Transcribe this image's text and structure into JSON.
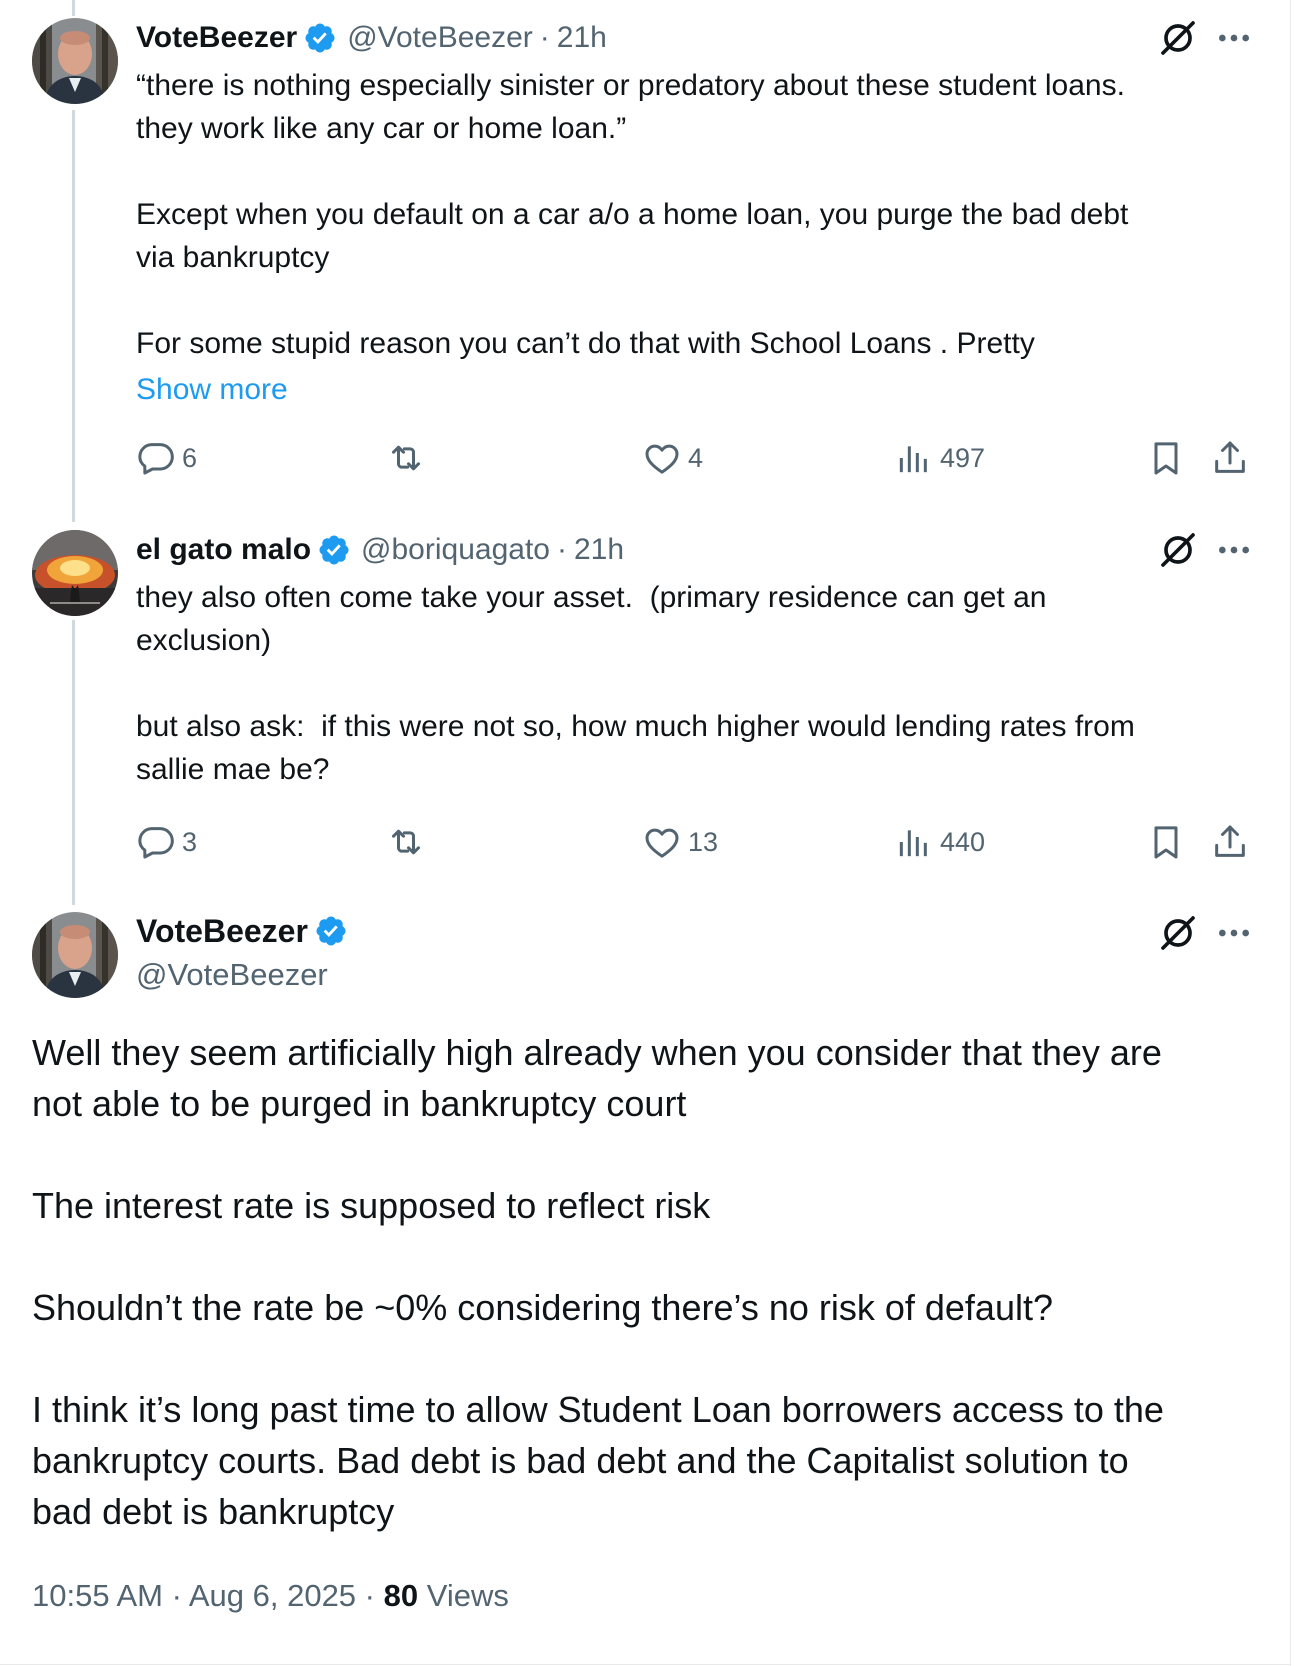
{
  "tweets": [
    {
      "name": "VoteBeezer",
      "handle": "@VoteBeezer",
      "separator": "·",
      "time": "21h",
      "text": "“there is nothing especially sinister or predatory about these student loans.\nthey work like any car or home loan.”\n\nExcept when you default on a car a/o a home loan, you purge the bad debt\nvia bankruptcy\n\nFor some stupid reason you can’t do that with School Loans . Pretty",
      "show_more": "Show more",
      "replies": "6",
      "reposts": "",
      "likes": "4",
      "views": "497"
    },
    {
      "name": "el gato malo",
      "handle": "@boriquagato",
      "separator": "·",
      "time": "21h",
      "text": "they also often come take your asset.  (primary residence can get an\nexclusion)\n\nbut also ask:  if this were not so, how much higher would lending rates from\nsallie mae be?",
      "replies": "3",
      "reposts": "",
      "likes": "13",
      "views": "440"
    }
  ],
  "main_tweet": {
    "name": "VoteBeezer",
    "handle": "@VoteBeezer",
    "text": "Well they seem artificially high already when you consider that they are\nnot able to be purged in bankruptcy court\n\nThe interest rate is supposed to reflect risk\n\nShouldn’t the rate be ~0% considering there’s no risk of default?\n\nI think it’s long past time to allow Student Loan borrowers access to the\nbankruptcy courts. Bad debt is bad debt and the Capitalist solution to\nbad debt is bankruptcy",
    "time": "10:55 AM",
    "date": "Aug 6, 2025",
    "separator": "·",
    "views_count": "80",
    "views_label": "Views"
  },
  "icons": {
    "verified": "verified-badge-icon",
    "grok": "grok-icon",
    "more": "more-dots-icon",
    "reply": "reply-icon",
    "repost": "repost-icon",
    "like": "like-icon",
    "views": "views-icon",
    "bookmark": "bookmark-icon",
    "share": "share-icon"
  },
  "colors": {
    "accent": "#1d9bf0",
    "secondary_text": "#536471",
    "primary_text": "#0f1419",
    "thread_line": "#cfd9de"
  }
}
